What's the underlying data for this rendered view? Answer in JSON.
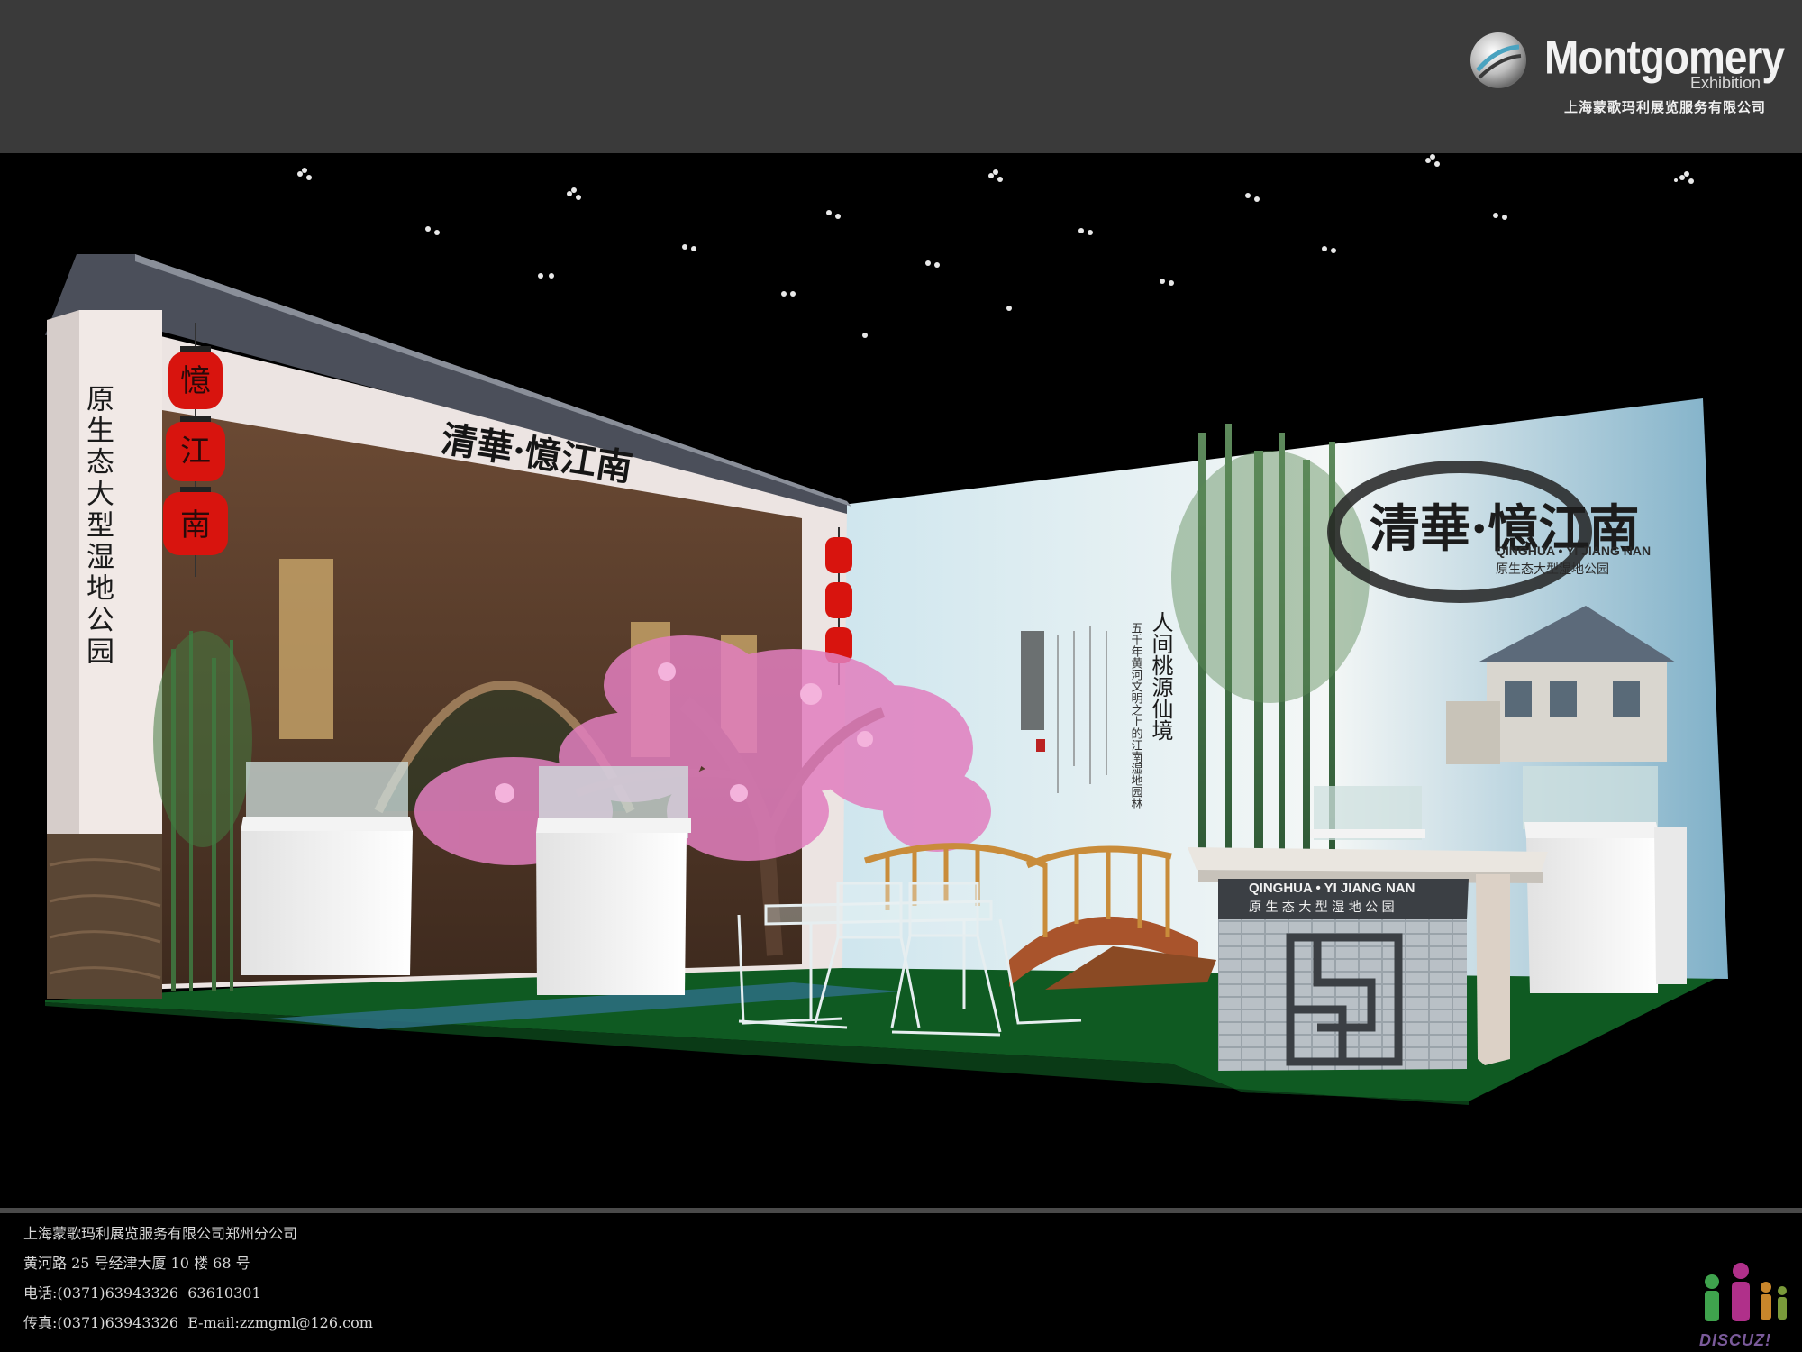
{
  "logo": {
    "name": "Montgomery",
    "sub": "Exhibition",
    "company_cn": "上海蒙歌玛利展览服务有限公司"
  },
  "booth": {
    "pillar_text": "原生态大型湿地公园",
    "lantern_chars": [
      "憶",
      "江",
      "南"
    ],
    "gate_title": "清華·憶江南",
    "wall_title": "清華·憶江南",
    "wall_subtitle_en": "QINGHUA • YI JIANG NAN",
    "wall_subtitle_cn": "原生态大型湿地公园",
    "poem_heading": "人间桃源仙境",
    "poem_line": "五千年黄河文明之上的江南湿地园林",
    "counter_en": "QINGHUA • YI JIANG NAN",
    "counter_cn": "原 生 态 大 型 湿 地 公 园"
  },
  "footer": {
    "lines": [
      "上海蒙歌玛利展览服务有限公司郑州分公司",
      "黄河路 25 号经津大厦 10 楼 68 号",
      "电话:(0371)63943326  63610301",
      "传真:(0371)63943326  E-mail:zzmgml@126.com"
    ]
  },
  "watermark": {
    "text": "DISCUZ!"
  },
  "colors": {
    "header_bg": "#3a3a3a",
    "lantern_red": "#d8140e",
    "carpet_green": "#0f5a22",
    "blossom_pink": "#e27fbf"
  }
}
